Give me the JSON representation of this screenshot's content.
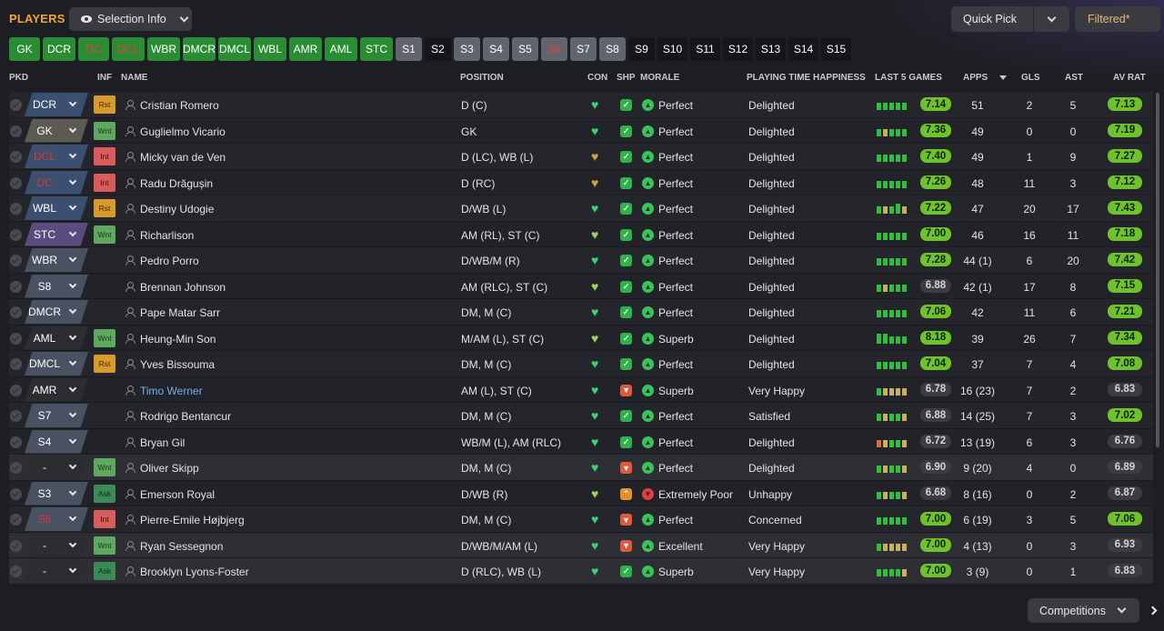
{
  "header": {
    "title": "PLAYERS",
    "selection_info": "Selection Info",
    "quick_pick": "Quick Pick",
    "filtered": "Filtered*"
  },
  "tabs": [
    {
      "label": "GK",
      "style": "green"
    },
    {
      "label": "DCR",
      "style": "green"
    },
    {
      "label": "DC",
      "style": "green red"
    },
    {
      "label": "DCL",
      "style": "green red"
    },
    {
      "label": "WBR",
      "style": "green"
    },
    {
      "label": "DMCR",
      "style": "green"
    },
    {
      "label": "DMCL",
      "style": "green"
    },
    {
      "label": "WBL",
      "style": "green"
    },
    {
      "label": "AMR",
      "style": "green"
    },
    {
      "label": "AML",
      "style": "green"
    },
    {
      "label": "STC",
      "style": "green"
    },
    {
      "label": "S1",
      "style": "gray"
    },
    {
      "label": "S2",
      "style": "dark"
    },
    {
      "label": "S3",
      "style": "gray"
    },
    {
      "label": "S4",
      "style": "gray"
    },
    {
      "label": "S5",
      "style": "gray"
    },
    {
      "label": "S6",
      "style": "gray red"
    },
    {
      "label": "S7",
      "style": "gray"
    },
    {
      "label": "S8",
      "style": "gray"
    },
    {
      "label": "S9",
      "style": "dark"
    },
    {
      "label": "S10",
      "style": "dark"
    },
    {
      "label": "S11",
      "style": "dark"
    },
    {
      "label": "S12",
      "style": "dark"
    },
    {
      "label": "S13",
      "style": "dark"
    },
    {
      "label": "S14",
      "style": "dark"
    },
    {
      "label": "S15",
      "style": "dark"
    }
  ],
  "columns": {
    "pkd": "PKD",
    "inf": "INF",
    "name": "NAME",
    "position": "POSITION",
    "con": "CON",
    "shp": "SHP",
    "morale": "MORALE",
    "pth": "PLAYING TIME HAPPINESS",
    "last5": "LAST 5 GAMES",
    "apps": "APPS",
    "gls": "GLS",
    "ast": "AST",
    "avrat": "AV RAT"
  },
  "players": [
    {
      "pos": "DCR",
      "pos_style": "",
      "inf": "Rst",
      "name": "Cristian Romero",
      "position": "D (C)",
      "con": "g",
      "shp": "g",
      "morale": "Perfect",
      "morale_c": "g",
      "pth": "Delighted",
      "last5": "ggggg",
      "l5rat": "7.14",
      "l5c": "g",
      "apps": "51",
      "gls": "2",
      "ast": "5",
      "avrat": "7.13",
      "avc": "g"
    },
    {
      "pos": "GK",
      "pos_style": "gk",
      "inf": "Wnt",
      "name": "Guglielmo Vicario",
      "position": "GK",
      "con": "g",
      "shp": "g",
      "morale": "Perfect",
      "morale_c": "g",
      "pth": "Delighted",
      "last5": "gyggg",
      "l5rat": "7.36",
      "l5c": "g",
      "apps": "49",
      "gls": "0",
      "ast": "0",
      "avrat": "7.19",
      "avc": "g"
    },
    {
      "pos": "DCL",
      "pos_style": "red",
      "inf": "Int",
      "name": "Micky van de Ven",
      "position": "D (LC), WB (L)",
      "con": "y",
      "shp": "g",
      "morale": "Perfect",
      "morale_c": "g",
      "pth": "Delighted",
      "last5": "ggggg",
      "l5rat": "7.40",
      "l5c": "g",
      "apps": "49",
      "gls": "1",
      "ast": "9",
      "avrat": "7.27",
      "avc": "g"
    },
    {
      "pos": "DC",
      "pos_style": "red",
      "inf": "Int",
      "name": "Radu Drăgușin",
      "position": "D (RC)",
      "con": "y",
      "shp": "g",
      "morale": "Perfect",
      "morale_c": "g",
      "pth": "Delighted",
      "last5": "ggggg",
      "l5rat": "7.26",
      "l5c": "g",
      "apps": "48",
      "gls": "11",
      "ast": "3",
      "avrat": "7.12",
      "avc": "g"
    },
    {
      "pos": "WBL",
      "pos_style": "",
      "inf": "Rst",
      "name": "Destiny Udogie",
      "position": "D/WB (L)",
      "con": "g",
      "shp": "g",
      "morale": "Perfect",
      "morale_c": "g",
      "pth": "Delighted",
      "last5": "gygHy",
      "l5rat": "7.22",
      "l5c": "g",
      "apps": "47",
      "gls": "20",
      "ast": "17",
      "avrat": "7.43",
      "avc": "g"
    },
    {
      "pos": "STC",
      "pos_style": "stc",
      "inf": "Wnt",
      "name": "Richarlison",
      "position": "AM (RL), ST (C)",
      "con": "lg",
      "shp": "g",
      "morale": "Perfect",
      "morale_c": "g",
      "pth": "Delighted",
      "last5": "ggggg",
      "l5rat": "7.00",
      "l5c": "g",
      "apps": "46",
      "gls": "16",
      "ast": "11",
      "avrat": "7.18",
      "avc": "g"
    },
    {
      "pos": "WBR",
      "pos_style": "sub",
      "inf": "",
      "name": "Pedro Porro",
      "position": "D/WB/M (R)",
      "con": "g",
      "shp": "g",
      "morale": "Perfect",
      "morale_c": "g",
      "pth": "Delighted",
      "last5": "ggggg",
      "l5rat": "7.28",
      "l5c": "g",
      "apps": "44 (1)",
      "gls": "6",
      "ast": "20",
      "avrat": "7.42",
      "avc": "g"
    },
    {
      "pos": "S8",
      "pos_style": "sub",
      "inf": "",
      "name": "Brennan Johnson",
      "position": "AM (RLC), ST (C)",
      "con": "lg",
      "shp": "g",
      "morale": "Perfect",
      "morale_c": "g",
      "pth": "Delighted",
      "last5": "gyggg",
      "l5rat": "6.88",
      "l5c": "gr",
      "apps": "42 (1)",
      "gls": "17",
      "ast": "8",
      "avrat": "7.15",
      "avc": "g"
    },
    {
      "pos": "DMCR",
      "pos_style": "sub",
      "inf": "",
      "name": "Pape Matar Sarr",
      "position": "DM, M (C)",
      "con": "g",
      "shp": "g",
      "morale": "Perfect",
      "morale_c": "g",
      "pth": "Delighted",
      "last5": "ggggg",
      "l5rat": "7.06",
      "l5c": "g",
      "apps": "42",
      "gls": "11",
      "ast": "6",
      "avrat": "7.21",
      "avc": "g"
    },
    {
      "pos": "AML",
      "pos_style": "none",
      "inf": "Wnt",
      "name": "Heung-Min Son",
      "position": "M/AM (L), ST (C)",
      "con": "lg",
      "shp": "g",
      "morale": "Superb",
      "morale_c": "g",
      "pth": "Delighted",
      "last5": "HHggg",
      "l5rat": "8.18",
      "l5c": "g",
      "apps": "39",
      "gls": "26",
      "ast": "7",
      "avrat": "7.34",
      "avc": "g"
    },
    {
      "pos": "DMCL",
      "pos_style": "sub",
      "inf": "Rst",
      "name": "Yves Bissouma",
      "position": "DM, M (C)",
      "con": "g",
      "shp": "g",
      "morale": "Perfect",
      "morale_c": "g",
      "pth": "Delighted",
      "last5": "ggggg",
      "l5rat": "7.04",
      "l5c": "g",
      "apps": "37",
      "gls": "7",
      "ast": "4",
      "avrat": "7.08",
      "avc": "g"
    },
    {
      "pos": "AMR",
      "pos_style": "none",
      "inf": "",
      "name": "Timo Werner",
      "link": true,
      "position": "AM (L), ST (C)",
      "con": "g",
      "shp": "r",
      "morale": "Superb",
      "morale_c": "g",
      "pth": "Very Happy",
      "last5": "gyyyy",
      "l5rat": "6.78",
      "l5c": "gr",
      "apps": "16 (23)",
      "gls": "7",
      "ast": "2",
      "avrat": "6.83",
      "avc": "gr"
    },
    {
      "pos": "S7",
      "pos_style": "sub",
      "inf": "",
      "name": "Rodrigo Bentancur",
      "position": "DM, M (C)",
      "con": "g",
      "shp": "g",
      "morale": "Perfect",
      "morale_c": "g",
      "pth": "Satisfied",
      "last5": "gyggy",
      "l5rat": "6.88",
      "l5c": "gr",
      "apps": "14 (25)",
      "gls": "7",
      "ast": "3",
      "avrat": "7.02",
      "avc": "g"
    },
    {
      "pos": "S4",
      "pos_style": "sub",
      "inf": "",
      "name": "Bryan Gil",
      "position": "WB/M (L), AM (RLC)",
      "con": "g",
      "shp": "g",
      "morale": "Perfect",
      "morale_c": "g",
      "pth": "Delighted",
      "last5": "ryggy",
      "l5rat": "6.72",
      "l5c": "gr",
      "apps": "13 (19)",
      "gls": "6",
      "ast": "3",
      "avrat": "6.76",
      "avc": "gr"
    },
    {
      "pos": "-",
      "pos_style": "none",
      "inf": "Wnt",
      "name": "Oliver Skipp",
      "position": "DM, M (C)",
      "con": "g",
      "shp": "r",
      "morale": "Perfect",
      "morale_c": "g",
      "pth": "Delighted",
      "last5": "gyggy",
      "l5rat": "6.90",
      "l5c": "gr",
      "apps": "9 (20)",
      "gls": "4",
      "ast": "0",
      "avrat": "6.89",
      "avc": "gr",
      "unpicked": true
    },
    {
      "pos": "S3",
      "pos_style": "sub",
      "inf": "Ask",
      "name": "Emerson Royal",
      "position": "D/WB (R)",
      "con": "lg",
      "shp": "o",
      "morale": "Extremely Poor",
      "morale_c": "r",
      "pth": "Unhappy",
      "last5": "gyggy",
      "l5rat": "6.68",
      "l5c": "gr",
      "apps": "8 (16)",
      "gls": "0",
      "ast": "2",
      "avrat": "6.87",
      "avc": "gr"
    },
    {
      "pos": "S6",
      "pos_style": "sub red",
      "inf": "Int",
      "name": "Pierre-Emile Højbjerg",
      "position": "DM, M (C)",
      "con": "g",
      "shp": "r",
      "morale": "Perfect",
      "morale_c": "g",
      "pth": "Concerned",
      "last5": "ggggg",
      "l5rat": "7.00",
      "l5c": "g",
      "apps": "6 (19)",
      "gls": "3",
      "ast": "5",
      "avrat": "7.06",
      "avc": "g"
    },
    {
      "pos": "-",
      "pos_style": "none",
      "inf": "Wnt",
      "name": "Ryan Sessegnon",
      "position": "D/WB/M/AM (L)",
      "con": "g",
      "shp": "r",
      "morale": "Excellent",
      "morale_c": "g",
      "pth": "Very Happy",
      "last5": "gyyyy",
      "l5rat": "7.00",
      "l5c": "g",
      "apps": "4 (13)",
      "gls": "0",
      "ast": "3",
      "avrat": "6.93",
      "avc": "gr",
      "unpicked": true
    },
    {
      "pos": "-",
      "pos_style": "none",
      "inf": "Ask",
      "name": "Brooklyn Lyons-Foster",
      "position": "D (RLC), WB (L)",
      "con": "g",
      "shp": "g",
      "morale": "Superb",
      "morale_c": "g",
      "pth": "Very Happy",
      "last5": "ggggy",
      "l5rat": "7.00",
      "l5c": "g",
      "apps": "3 (9)",
      "gls": "0",
      "ast": "1",
      "avrat": "6.83",
      "avc": "gr",
      "unpicked": true
    }
  ],
  "footer": {
    "competitions": "Competitions"
  }
}
